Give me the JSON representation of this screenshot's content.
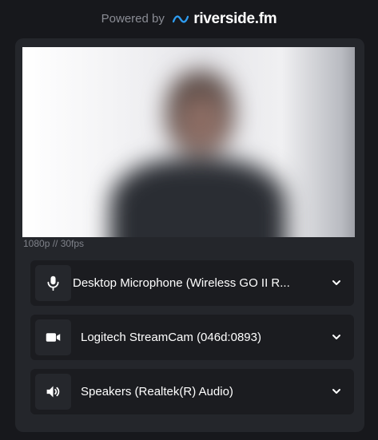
{
  "header": {
    "powered_by": "Powered by",
    "brand": "riverside.fm"
  },
  "video": {
    "quality": "1080p // 30fps"
  },
  "devices": {
    "microphone": {
      "label": "Desktop Microphone (Wireless GO II R...",
      "icon": "microphone-icon"
    },
    "camera": {
      "label": "Logitech StreamCam (046d:0893)",
      "icon": "camera-icon"
    },
    "speaker": {
      "label": "Speakers (Realtek(R) Audio)",
      "icon": "speaker-icon"
    }
  },
  "colors": {
    "accent": "#2e9cf0",
    "background": "#17181c",
    "card": "#24262b",
    "row": "#1b1c20"
  }
}
